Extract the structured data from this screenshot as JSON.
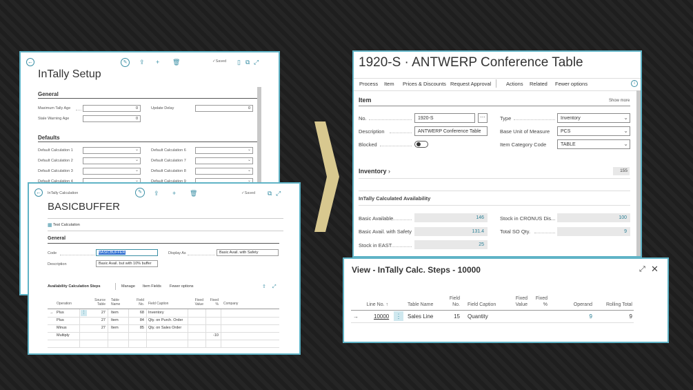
{
  "setup": {
    "title": "InTally Setup",
    "saved": "✓Saved",
    "general": "General",
    "fields": [
      {
        "label": "Maximum Tally Age",
        "value": "0"
      },
      {
        "label": "Stale Warning Age",
        "value": "0"
      },
      {
        "label": "Update Delay",
        "value": "0"
      }
    ],
    "defaults": "Defaults",
    "default_left": [
      "Default Calculation 1",
      "Default Calculation 2",
      "Default Calculation 3",
      "Default Calculation 4"
    ],
    "default_right": [
      "Default Calculation 6",
      "Default Calculation 7",
      "Default Calculation 8",
      "Default Calculation 9"
    ]
  },
  "calc": {
    "breadcrumb": "InTally Calculation",
    "saved": "✓Saved",
    "title": "BASICBUFFER",
    "test_action": "Test Calculation",
    "general": "General",
    "code_label": "Code",
    "code_value": "BASICBUFFER",
    "description_label": "Description",
    "description_value": "Basic Avail. but with 10% buffer",
    "display_as_label": "Display As",
    "display_as_value": "Basic Avail. with Safety",
    "steps_title": "Availability Calculation Steps",
    "steps_actions": [
      "Manage",
      "Item Fields",
      "Fewer options"
    ],
    "columns": [
      "Operation",
      "Source Table",
      "Table Name",
      "Field No.",
      "Field Caption",
      "Fixed Value",
      "Fixed %",
      "Company"
    ],
    "rows": [
      {
        "operation": "Plus",
        "source_table": "27",
        "table_name": "Item",
        "field_no": "68",
        "field_caption": "Inventory",
        "fixed_value": "",
        "fixed_pct": ""
      },
      {
        "operation": "Plus",
        "source_table": "27",
        "table_name": "Item",
        "field_no": "84",
        "field_caption": "Qty. on Purch. Order",
        "fixed_value": "",
        "fixed_pct": ""
      },
      {
        "operation": "Minus",
        "source_table": "27",
        "table_name": "Item",
        "field_no": "85",
        "field_caption": "Qty. on Sales Order",
        "fixed_value": "",
        "fixed_pct": ""
      },
      {
        "operation": "Multiply",
        "source_table": "",
        "table_name": "",
        "field_no": "",
        "field_caption": "",
        "fixed_value": "",
        "fixed_pct": "-10"
      }
    ]
  },
  "item": {
    "title": "1920-S · ANTWERP Conference Table",
    "menu": [
      "Process",
      "Item",
      "Prices & Discounts",
      "Request Approval",
      "Actions",
      "Related",
      "Fewer options"
    ],
    "section": "Item",
    "show_more": "Show more",
    "no_label": "No.",
    "no_value": "1920-S",
    "description_label": "Description",
    "description_value": "ANTWERP Conference Table",
    "blocked_label": "Blocked",
    "type_label": "Type",
    "type_value": "Inventory",
    "uom_label": "Base Unit of Measure",
    "uom_value": "PCS",
    "category_label": "Item Category Code",
    "category_value": "TABLE",
    "inventory_label": "Inventory",
    "inventory_value": "155",
    "intally_section": "InTally Calculated Availability",
    "avail": [
      {
        "label": "Basic Available",
        "value": "146"
      },
      {
        "label": "Basic Avail. with Safety",
        "value": "131.4"
      },
      {
        "label": "Stock in EAST",
        "value": "25"
      }
    ],
    "avail_right": [
      {
        "label": "Stock in CRONUS Dis...",
        "value": "100"
      },
      {
        "label": "Total SO Qty.",
        "value": "9"
      }
    ]
  },
  "steps_view": {
    "title": "View - InTally Calc. Steps - 10000",
    "columns": [
      "Line No. ↑",
      "Table Name",
      "Field No.",
      "Field Caption",
      "Fixed Value",
      "Fixed %",
      "Operand",
      "Rolling Total"
    ],
    "row": {
      "line_no": "10000",
      "table_name": "Sales Line",
      "field_no": "15",
      "field_caption": "Quantity",
      "fixed_value": "",
      "fixed_pct": "",
      "operand": "9",
      "rolling_total": "9"
    }
  },
  "colors": {
    "accent": "#5fb3c6",
    "link": "#2a7f95",
    "arrow": "#d8c88f",
    "background": "#1e1e1e"
  }
}
